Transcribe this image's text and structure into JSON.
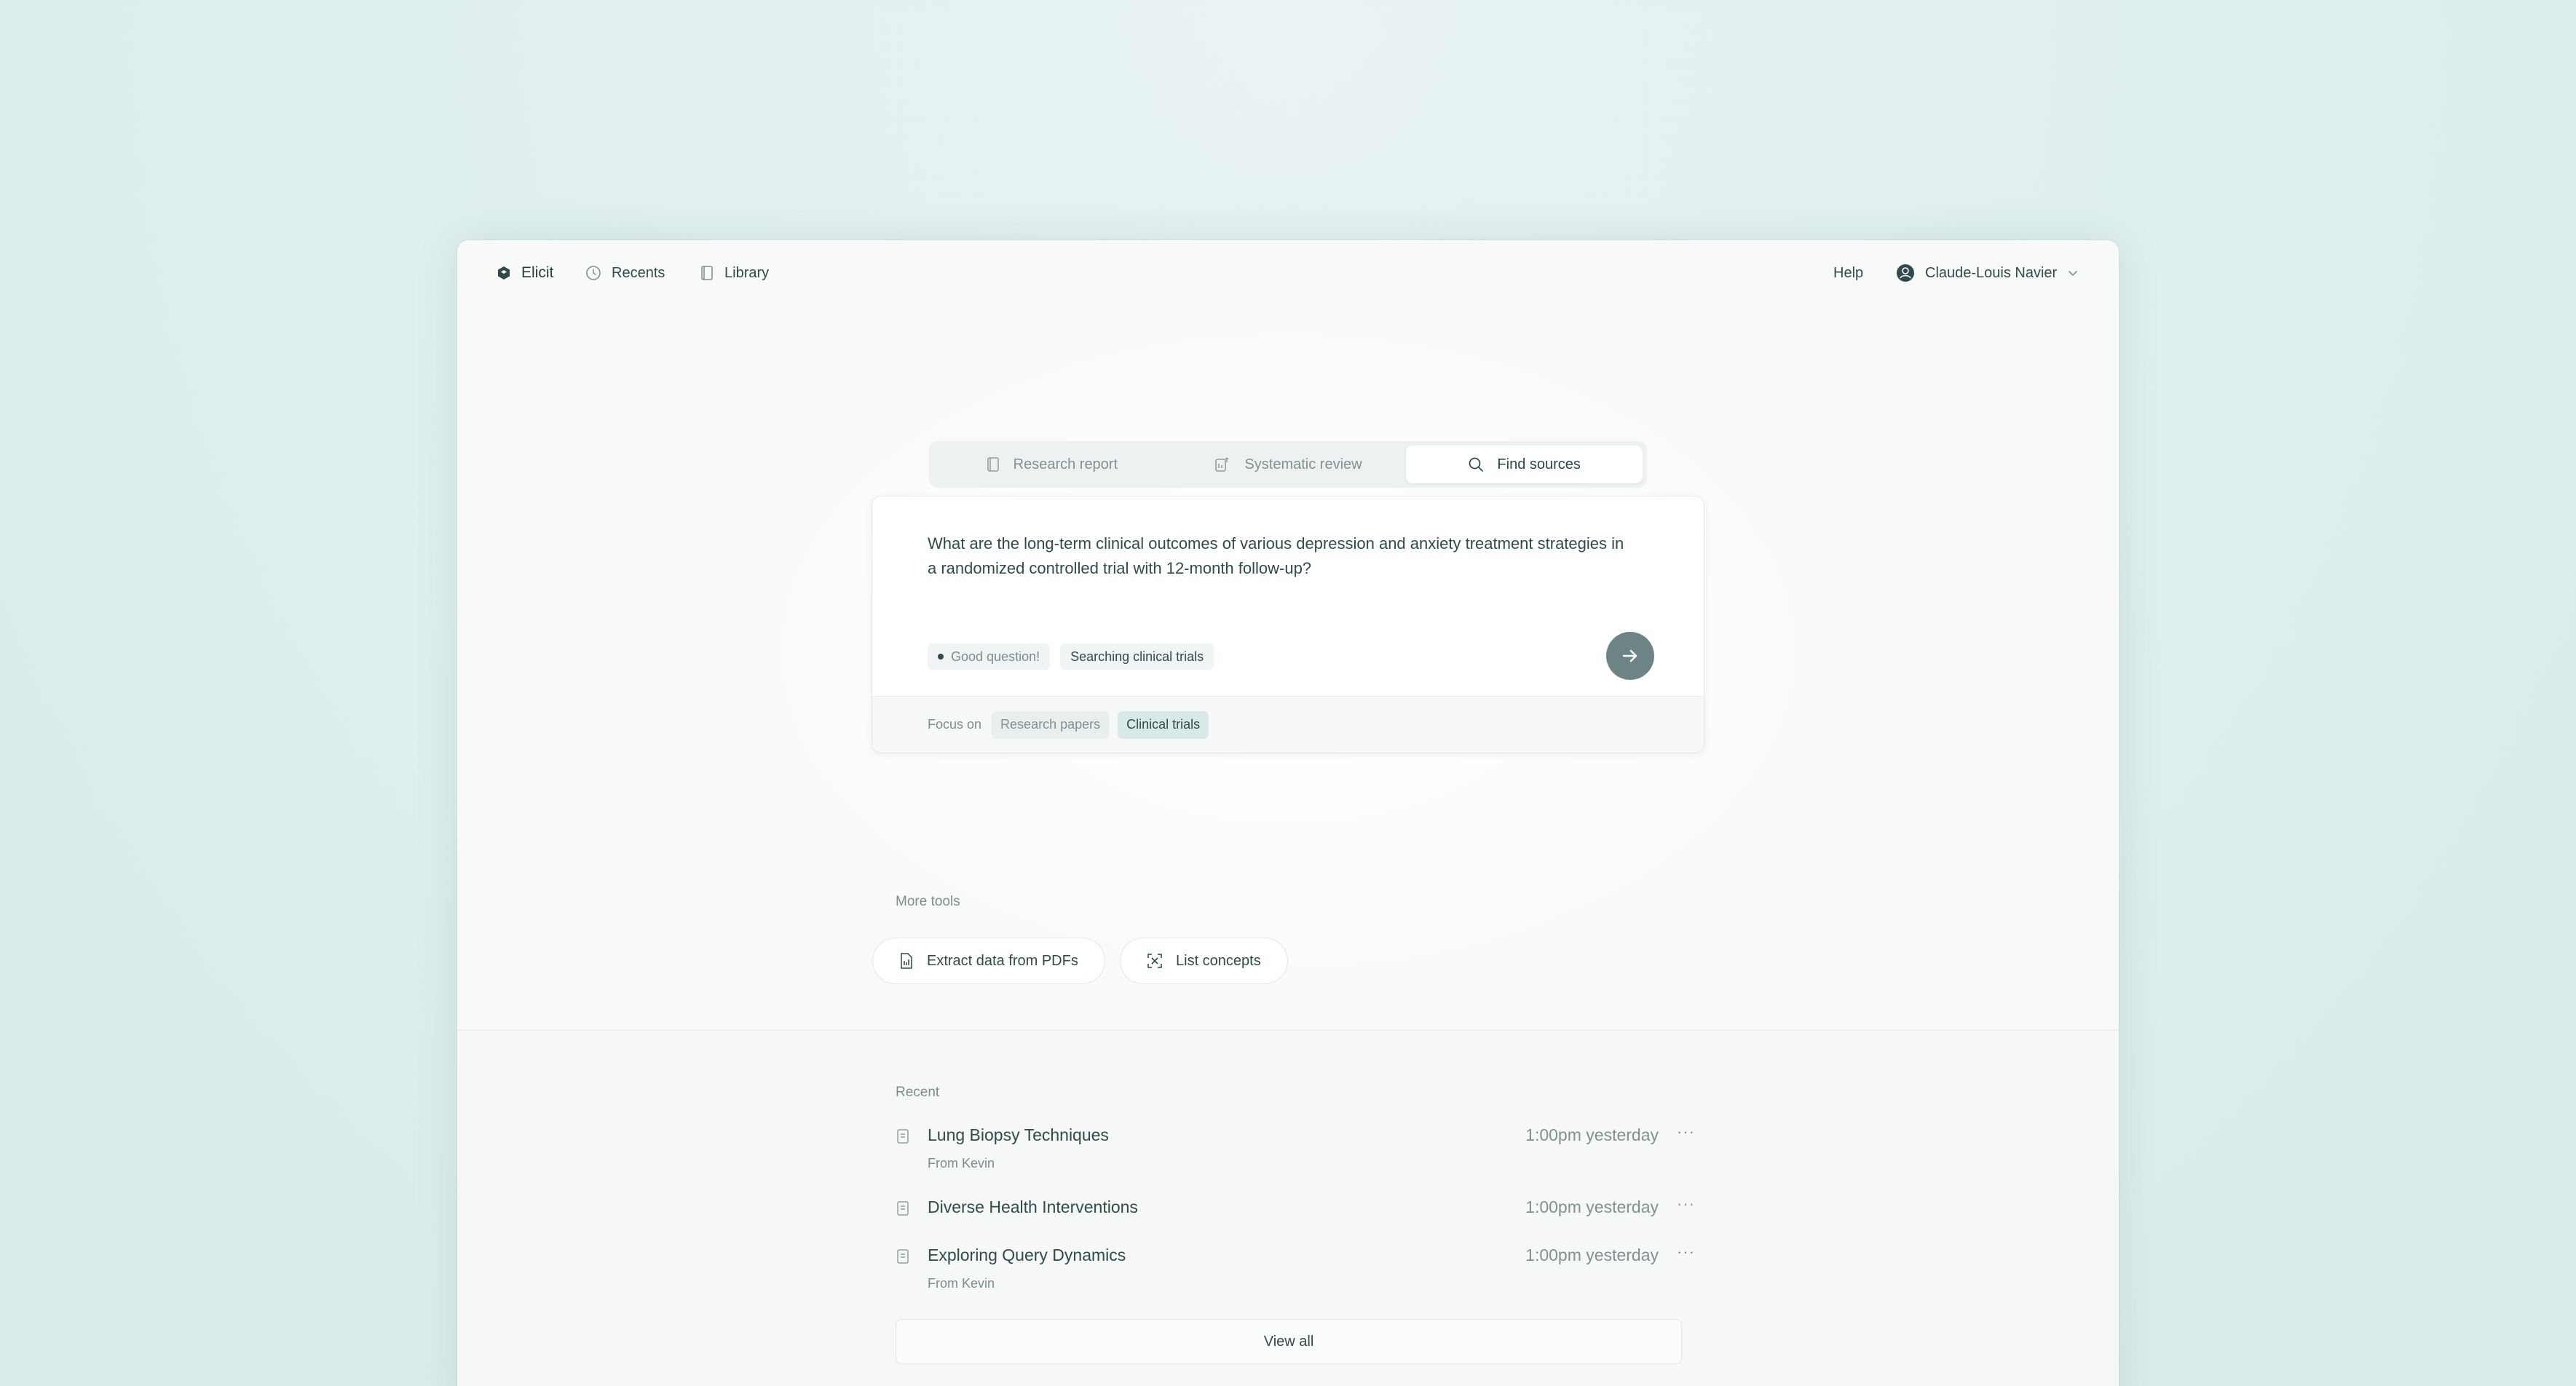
{
  "nav": {
    "brand": "Elicit",
    "recents": "Recents",
    "library": "Library",
    "help": "Help",
    "user": "Claude-Louis Navier"
  },
  "tabs": [
    {
      "label": "Research report",
      "icon": "report-icon"
    },
    {
      "label": "Systematic review",
      "icon": "review-icon"
    },
    {
      "label": "Find sources",
      "icon": "search-icon",
      "active": true
    }
  ],
  "search": {
    "query": "What are the long-term clinical outcomes of various depression and anxiety treatment strategies in a randomized controlled trial with 12-month follow-up?",
    "chips": [
      "Good question!",
      "Searching clinical trials"
    ],
    "focus_label": "Focus on",
    "focus_options": [
      "Research papers",
      "Clinical trials"
    ],
    "focus_selected": "Clinical trials"
  },
  "more_tools": {
    "label": "More tools",
    "tools": [
      "Extract data from PDFs",
      "List concepts"
    ]
  },
  "recent": {
    "label": "Recent",
    "items": [
      {
        "title": "Lung Biopsy Techniques",
        "sub": "From Kevin",
        "time": "1:00pm yesterday"
      },
      {
        "title": "Diverse Health Interventions",
        "sub": "",
        "time": "1:00pm yesterday"
      },
      {
        "title": "Exploring Query Dynamics",
        "sub": "From Kevin",
        "time": "1:00pm yesterday"
      }
    ],
    "more_glyph": "···",
    "view_all": "View all"
  },
  "colors": {
    "accent": "#2f4b4a",
    "submit": "#6c8584",
    "page_bg": "#e3f0ef",
    "selected_focus": "#d9e9e7"
  }
}
